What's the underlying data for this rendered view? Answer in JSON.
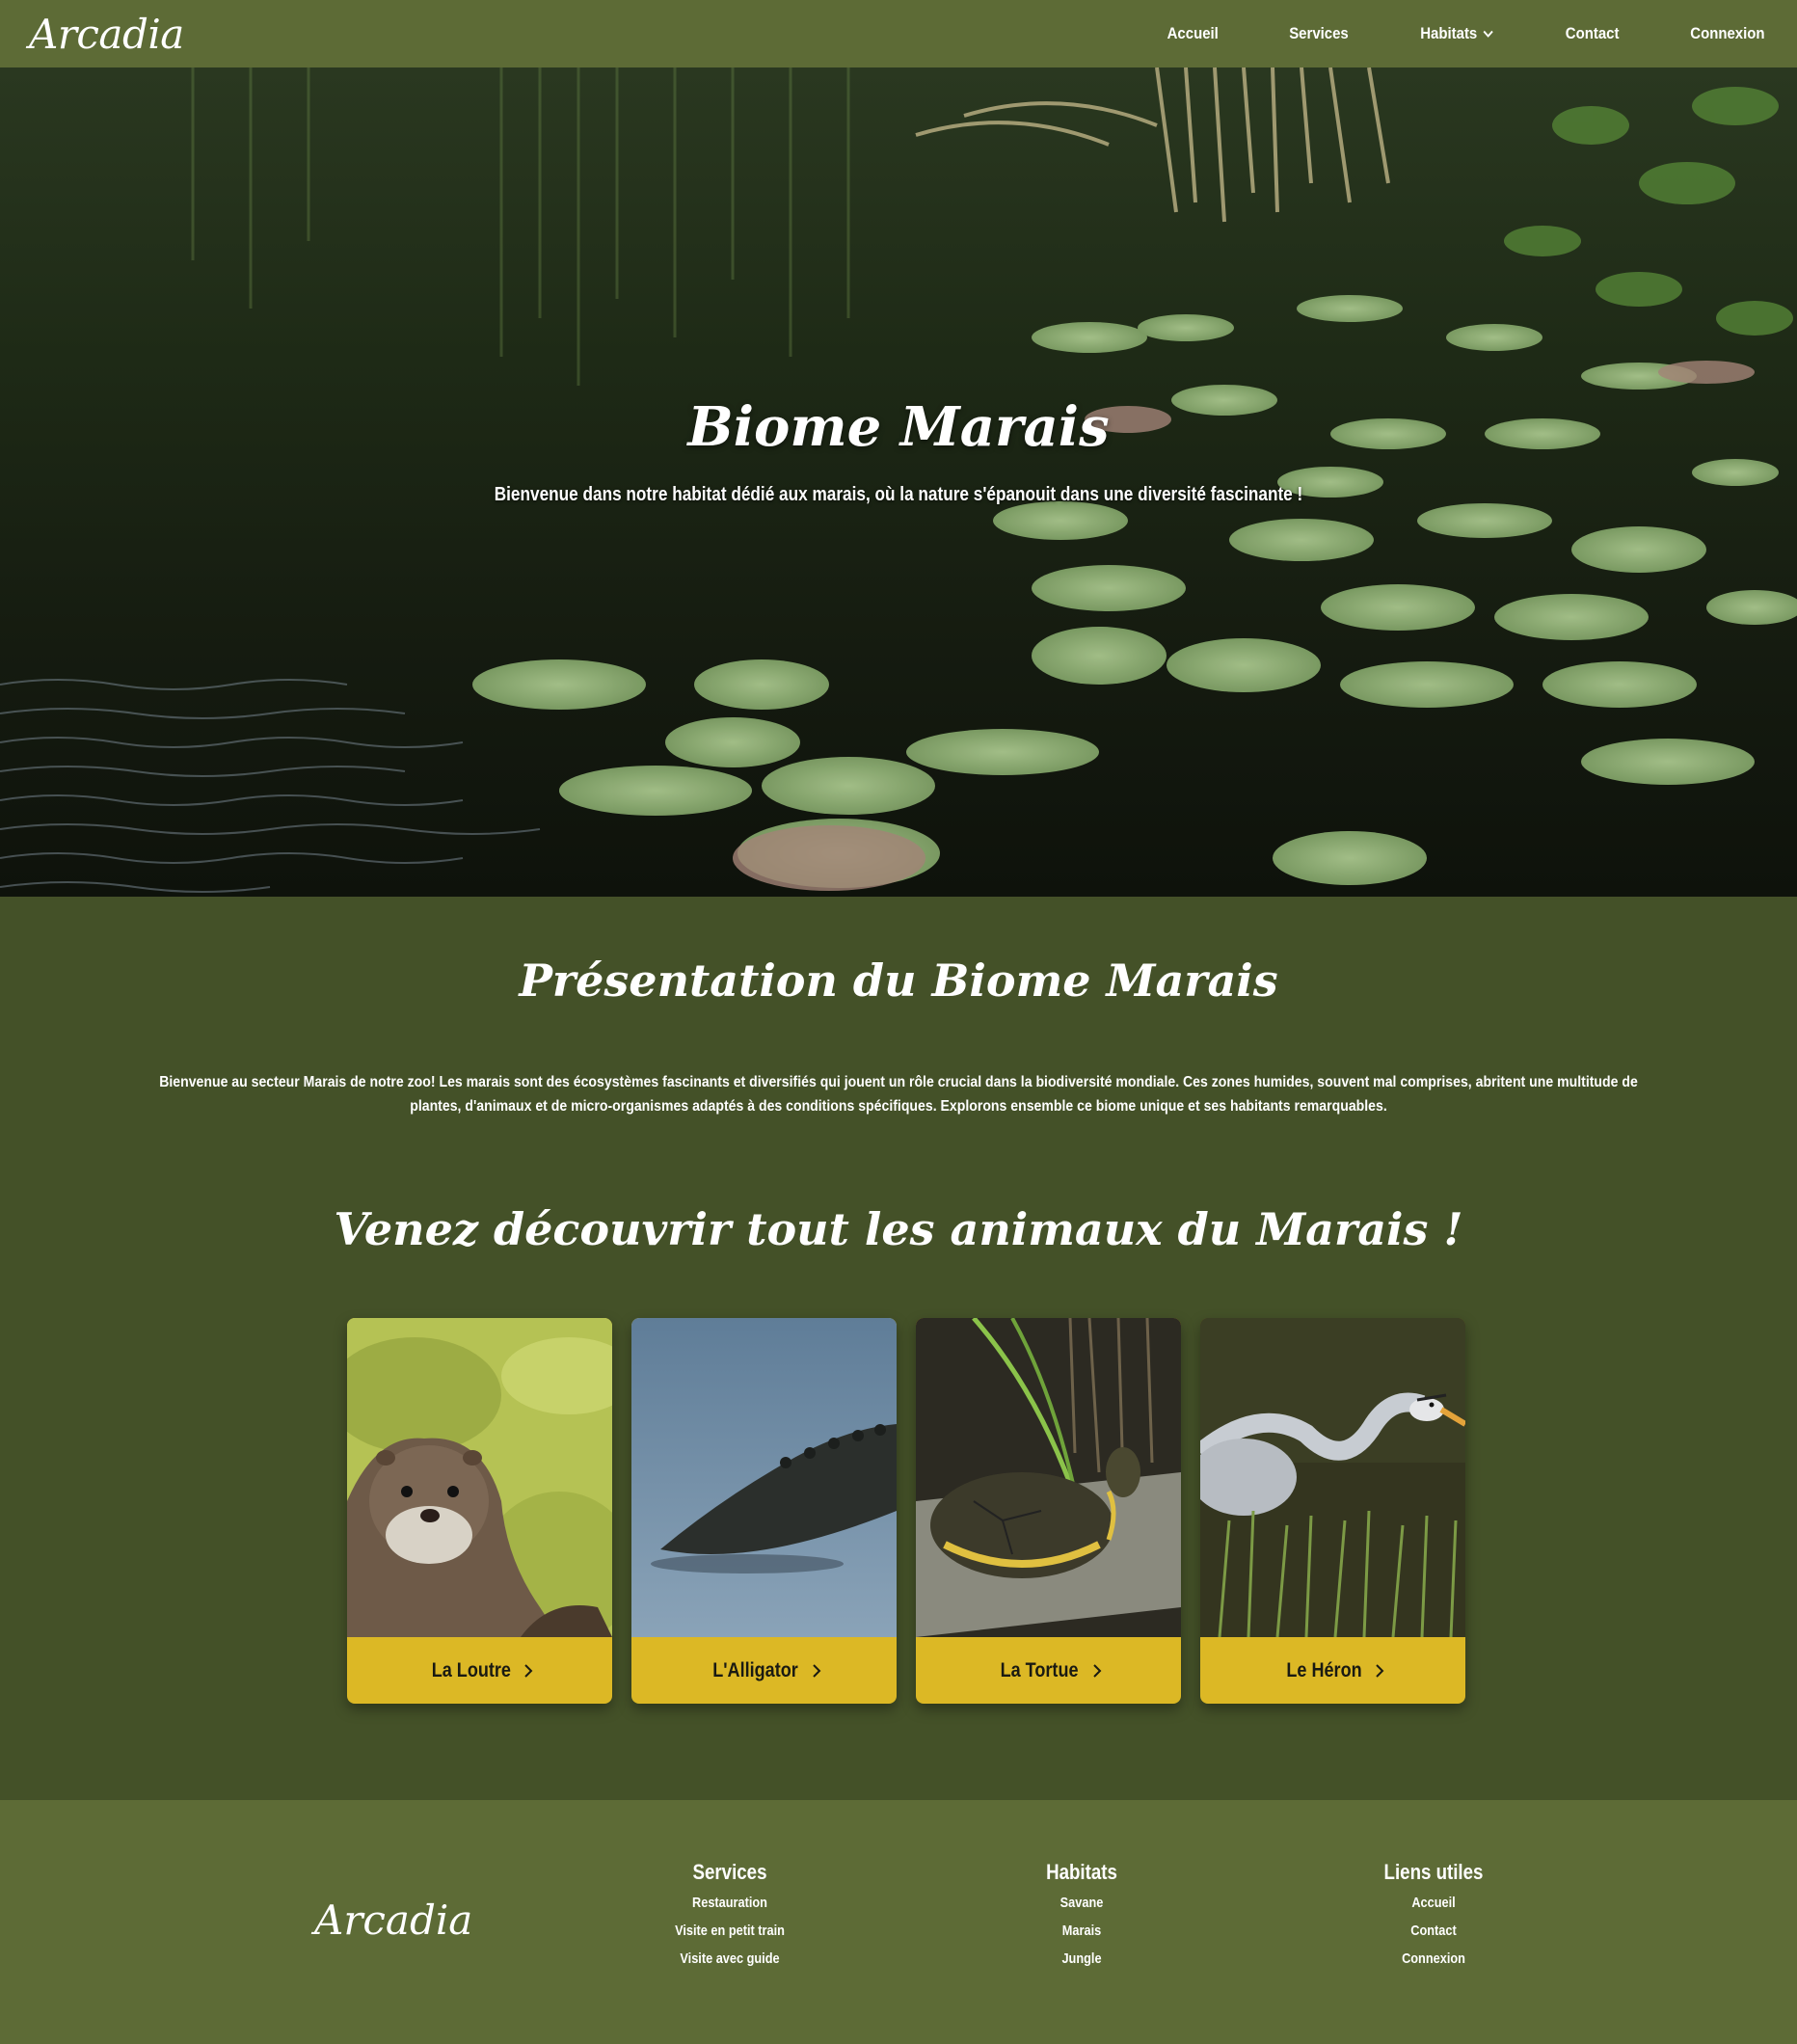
{
  "nav": {
    "brand": "Arcadia",
    "links": {
      "home": "Accueil",
      "services": "Services",
      "habitats": "Habitats",
      "contact": "Contact",
      "login": "Connexion"
    }
  },
  "hero": {
    "title": "Biome Marais",
    "subtitle": "Bienvenue dans notre habitat dédié aux marais, où la nature s'épanouit dans une diversité fascinante !"
  },
  "presentation": {
    "title": "Présentation du Biome Marais",
    "text": "Bienvenue au secteur Marais de notre zoo! Les marais sont des écosystèmes fascinants et diversifiés qui jouent un rôle crucial dans la biodiversité mondiale. Ces zones humides, souvent mal comprises, abritent une multitude de plantes, d'animaux et de micro-organismes adaptés à des conditions spécifiques. Explorons ensemble ce biome unique et ses habitants remarquables."
  },
  "animals": {
    "title": "Venez découvrir tout les animaux du Marais !",
    "cards": [
      {
        "label": "La Loutre",
        "icon": "otter-photo"
      },
      {
        "label": "L'Alligator",
        "icon": "alligator-photo"
      },
      {
        "label": "La Tortue",
        "icon": "turtle-photo"
      },
      {
        "label": "Le Héron",
        "icon": "heron-photo"
      }
    ]
  },
  "footer": {
    "brand": "Arcadia",
    "services": {
      "title": "Services",
      "items": [
        "Restauration",
        "Visite en petit train",
        "Visite avec guide"
      ]
    },
    "habitats": {
      "title": "Habitats",
      "items": [
        "Savane",
        "Marais",
        "Jungle"
      ]
    },
    "links": {
      "title": "Liens utiles",
      "items": [
        "Accueil",
        "Contact",
        "Connexion"
      ]
    }
  },
  "colors": {
    "nav_bg": "#5d6b36",
    "page_bg": "#445128",
    "button_yellow": "#dcb825"
  }
}
